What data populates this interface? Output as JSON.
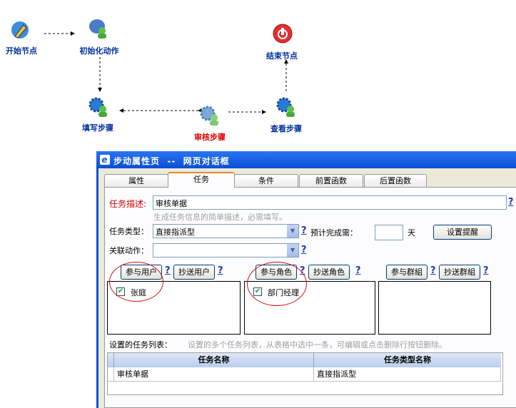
{
  "workflow": {
    "nodes": [
      {
        "id": "start",
        "label": "开始节点",
        "icon": "pen-icon"
      },
      {
        "id": "init",
        "label": "初始化动作",
        "icon": "user-chat-icon"
      },
      {
        "id": "end",
        "label": "结束节点",
        "icon": "stop-icon"
      },
      {
        "id": "fill",
        "label": "填写步骤",
        "icon": "gear-user-icon"
      },
      {
        "id": "review",
        "label": "审核步骤",
        "icon": "gear-user-icon",
        "color": "#e00000"
      },
      {
        "id": "view",
        "label": "查看步骤",
        "icon": "gear-user-icon"
      }
    ]
  },
  "dialog": {
    "title": "步动属性页  --  网页对话框",
    "tabs": [
      "属性",
      "任务",
      "条件",
      "前置函数",
      "后置函数"
    ],
    "active_tab": "任务",
    "task_desc_label": "任务描述:",
    "task_desc_value": "审核单据",
    "task_desc_hint": "生成任务信息的简单描述，必需填写。",
    "task_type_label": "任务类型：",
    "task_type_value": "直接指派型",
    "est_label": "预计完成需：",
    "est_value": "",
    "est_unit": "天",
    "reminder_button": "设置提醒",
    "linked_action_label": "关联动作：",
    "linked_action_value": "",
    "help": "?",
    "groups": [
      {
        "btn1": "参与用户",
        "btn2": "抄送用户",
        "items": [
          {
            "label": "张庭",
            "checked": true
          }
        ]
      },
      {
        "btn1": "参与角色",
        "btn2": "抄送角色",
        "items": [
          {
            "label": "部门经理",
            "checked": true
          }
        ]
      },
      {
        "btn1": "参与群組",
        "btn2": "抄送群組",
        "items": []
      }
    ],
    "task_list_label": "设置的任务列表：",
    "task_list_hint": "设置的多个任务列表，从表格中选中一条，可编辑或点击删除行按钮删除。",
    "table": {
      "columns": [
        "任务名称",
        "任务类型名称"
      ],
      "rows": [
        [
          "审核单据",
          "直接指派型"
        ]
      ]
    },
    "colors": {
      "title_bar": "#0a52d8",
      "required_label": "#d00000",
      "help": "#1c3ab5"
    }
  }
}
